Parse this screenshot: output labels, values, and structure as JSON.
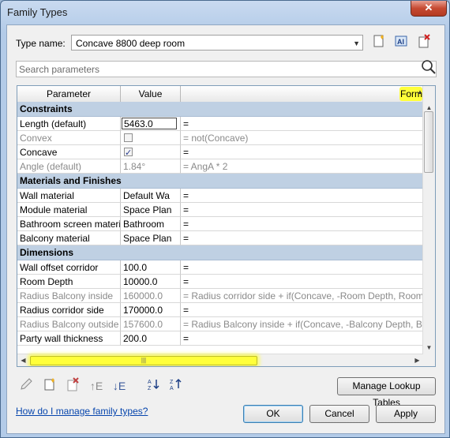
{
  "window": {
    "title": "Family Types",
    "close_label": "✕"
  },
  "type_name": {
    "label": "Type name:",
    "value": "Concave 8800 deep room"
  },
  "toolbar_icons": {
    "new_type": "new-type-icon",
    "rename_type": "rename-type-icon",
    "delete_type": "delete-type-icon"
  },
  "search": {
    "placeholder": "Search parameters"
  },
  "grid": {
    "headers": {
      "parameter": "Parameter",
      "value": "Value",
      "formula": "Formula"
    },
    "groups": [
      {
        "title": "Constraints",
        "rows": [
          {
            "name": "Length (default)",
            "value": "5463.0",
            "formula": "=",
            "disabled": false,
            "editing": true
          },
          {
            "name": "Convex",
            "value": "",
            "checkbox": false,
            "formula": "= not(Concave)",
            "disabled": true
          },
          {
            "name": "Concave",
            "value": "",
            "checkbox": true,
            "formula": "=",
            "disabled": false
          },
          {
            "name": "Angle (default)",
            "value": "1.84°",
            "formula": "= AngA * 2",
            "disabled": true
          }
        ]
      },
      {
        "title": "Materials and Finishes",
        "rows": [
          {
            "name": "Wall material",
            "value": "Default Wa",
            "formula": "=",
            "disabled": false
          },
          {
            "name": "Module material",
            "value": "Space Plan",
            "formula": "=",
            "disabled": false
          },
          {
            "name": "Bathroom screen materi",
            "value": "Bathroom",
            "formula": "=",
            "disabled": false
          },
          {
            "name": "Balcony material",
            "value": "Space Plan",
            "formula": "=",
            "disabled": false
          }
        ]
      },
      {
        "title": "Dimensions",
        "rows": [
          {
            "name": "Wall offset corridor",
            "value": "100.0",
            "formula": "=",
            "disabled": false
          },
          {
            "name": "Room Depth",
            "value": "10000.0",
            "formula": "=",
            "disabled": false
          },
          {
            "name": "Radius Balcony inside",
            "value": "160000.0",
            "formula": "= Radius corridor side + if(Concave, -Room Depth, Room D",
            "disabled": true
          },
          {
            "name": "Radius corridor side",
            "value": "170000.0",
            "formula": "=",
            "disabled": false
          },
          {
            "name": "Radius Balcony outside",
            "value": "157600.0",
            "formula": "= Radius Balcony inside + if(Concave, -Balcony Depth, Balc",
            "disabled": true
          },
          {
            "name": "Party wall thickness",
            "value": "200.0",
            "formula": "=",
            "disabled": false
          }
        ]
      }
    ]
  },
  "bottom_icons": [
    "edit-parameter-icon",
    "new-parameter-icon",
    "delete-parameter-icon",
    "move-up-icon",
    "move-down-icon",
    "sort-ascending-icon",
    "sort-descending-icon"
  ],
  "buttons": {
    "manage_lookup": "Manage Lookup Tables",
    "ok": "OK",
    "cancel": "Cancel",
    "apply": "Apply"
  },
  "help_link": "How do I manage family types?"
}
